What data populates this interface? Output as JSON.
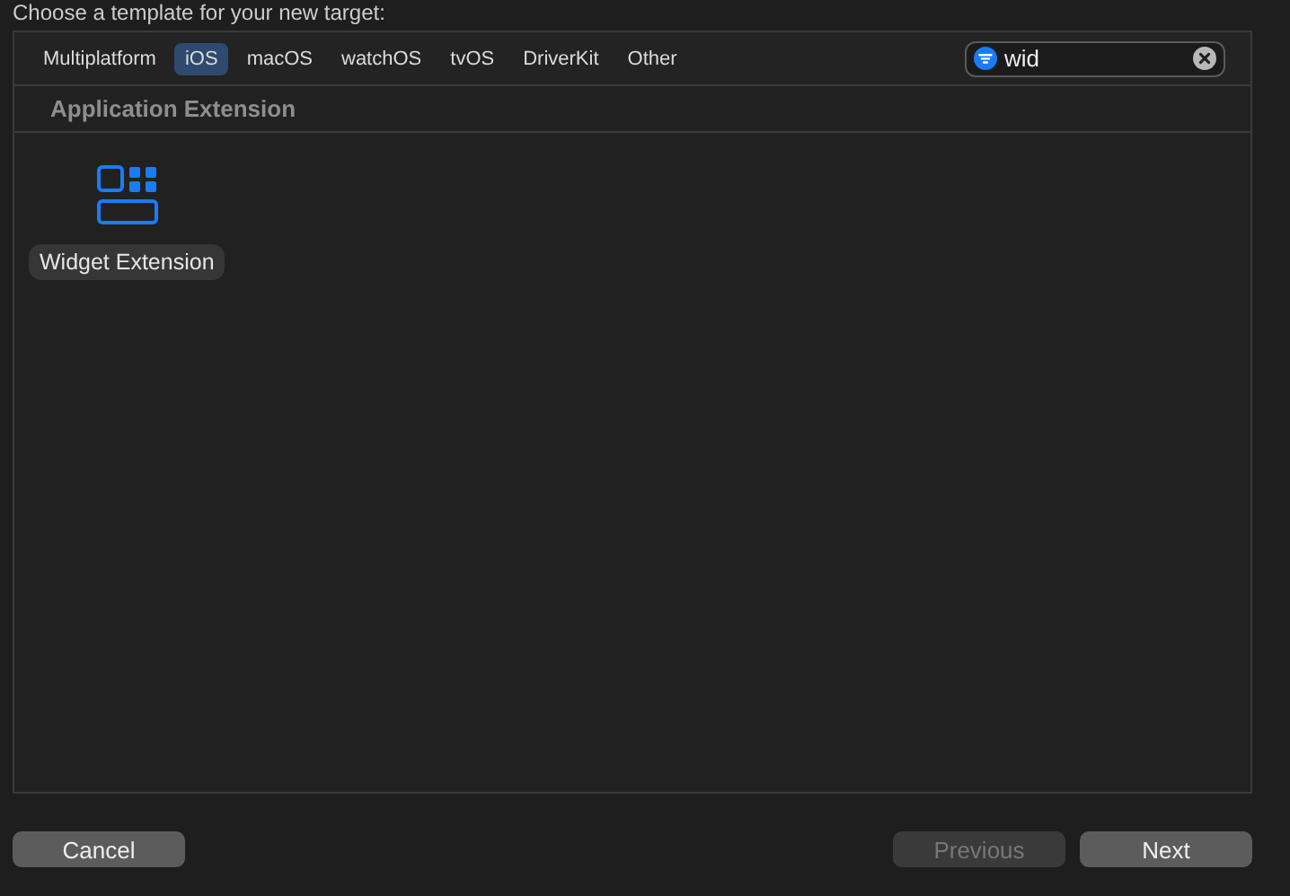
{
  "heading": "Choose a template for your new target:",
  "tabs": [
    {
      "label": "Multiplatform",
      "selected": false
    },
    {
      "label": "iOS",
      "selected": true
    },
    {
      "label": "macOS",
      "selected": false
    },
    {
      "label": "watchOS",
      "selected": false
    },
    {
      "label": "tvOS",
      "selected": false
    },
    {
      "label": "DriverKit",
      "selected": false
    },
    {
      "label": "Other",
      "selected": false
    }
  ],
  "search": {
    "value": "wid"
  },
  "section": {
    "title": "Application Extension",
    "templates": [
      {
        "label": "Widget Extension",
        "selected": true
      }
    ]
  },
  "buttons": [
    {
      "label": "Cancel",
      "disabled": false
    },
    {
      "label": "Previous",
      "disabled": true
    },
    {
      "label": "Next",
      "disabled": false
    }
  ]
}
